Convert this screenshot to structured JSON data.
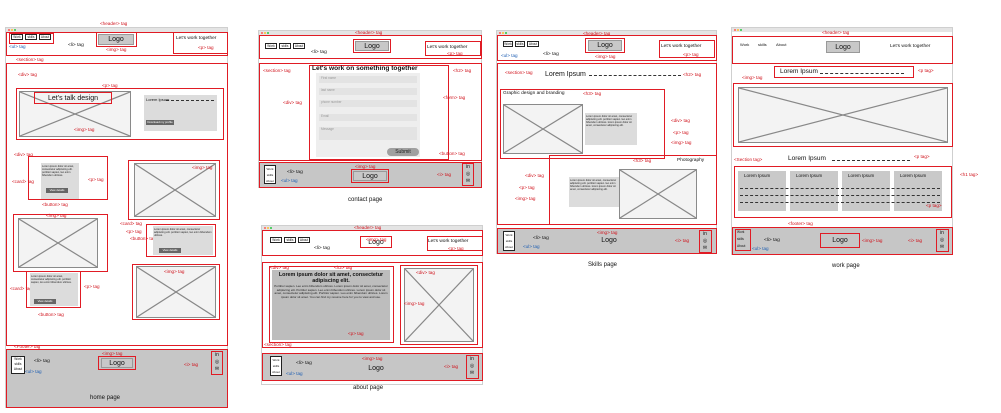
{
  "tags": {
    "header": "<header> tag",
    "ul": "<ul> tag",
    "li": "<li> tag",
    "img": "<img> tag",
    "p": "<p> tag",
    "section": "<section> tag",
    "div": "<div> tag",
    "card": "<card> tag",
    "button": "<button> tag",
    "footer": "<Footer> tag",
    "i": "<i> tag",
    "h2": "<h2> tag",
    "h3": "<h3> tag",
    "form": "<form> tag",
    "section_cap": "<Section tag>",
    "h1": "<h1 tag>",
    "p_cap": "<p tag>",
    "footer_lc": "<footer> tag",
    "div_tag2": "<div tag>"
  },
  "nav": {
    "work": "Work",
    "skills": "skills",
    "about": "About"
  },
  "logo": "Logo",
  "tagline": "Let's work together",
  "home": {
    "caption": "home page",
    "hero_title": "Let's talk design",
    "hero_side_title": "Lorem Ipsum",
    "hero_side_btn": "Download my profile",
    "card_text": "Lorem ipsum dolor sit amet, consectetur adipiscing elit. porttitor sapien, leo enim bibendum ultrices.",
    "card_btn": "View details"
  },
  "contact": {
    "caption": "contact page",
    "heading": "Let's work on something together",
    "fields": [
      "First name",
      "last name",
      "phone number",
      "Email",
      "Message"
    ],
    "submit": "Submit"
  },
  "about": {
    "caption": "about page",
    "heading": "Lorem ipsum dolor sit amet, consectetur adipiscing elit.",
    "body": "Porttitor sapien. Leo enim bibendum ultrices. Lorem ipsum dolor sit amet, consectetur adipiscing elit. Porttitor sapien. Leo enim bibendum ultrices. Lorem ipsum dolor sit amet, consectetur adipiscing elit. Porttitor sapien. Leo enim bibendum ultrices. Lorem ipsum dolor sit amet. You can find my resume here for you to view and use."
  },
  "skills": {
    "caption": "Skills page",
    "heading": "Lorem Ipsum",
    "sub1": "Graphic design and branding",
    "sub2": "Photography",
    "body": "Lorem ipsum dolor sit amet, consectetur adipiscing elit. porttitor sapien. leo enim bibendum ultrices. lorem ipsum dolor sit amet, consectetur adipiscing elit."
  },
  "work": {
    "caption": "work page",
    "heading": "Lorem Ipsum",
    "section_heading": "Lorem Ipsum",
    "col": "Lorem Ipsum"
  }
}
